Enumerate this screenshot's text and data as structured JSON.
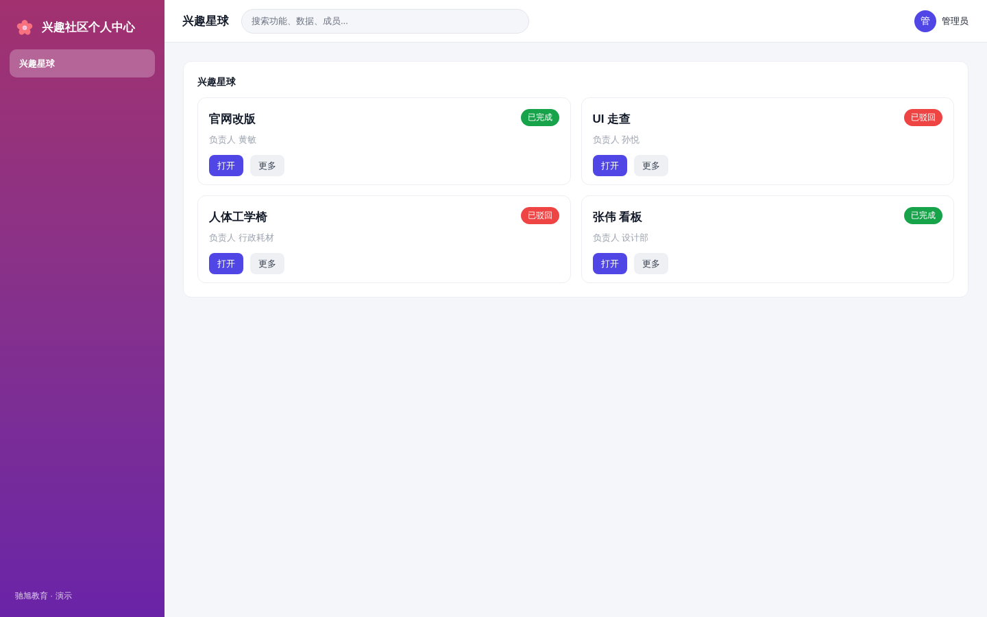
{
  "sidebar": {
    "brand": "兴趣社区个人中心",
    "items": [
      {
        "label": "兴趣星球",
        "selected": true
      }
    ],
    "footer": "驰旭教育 · 演示"
  },
  "header": {
    "title": "兴趣星球",
    "search": {
      "placeholder": "搜索功能、数据、成员..."
    },
    "user": {
      "avatar": "管",
      "name": "管理员"
    }
  },
  "panel": {
    "title": "兴趣星球",
    "cards": [
      {
        "title": "官网改版",
        "status": {
          "label": "已完成",
          "kind": "done"
        },
        "owner": "负责人 黄敏",
        "actions": [
          "打开",
          "更多"
        ]
      },
      {
        "title": "UI 走查",
        "status": {
          "label": "已驳回",
          "kind": "rejected"
        },
        "owner": "负责人 孙悦",
        "actions": [
          "打开",
          "更多"
        ]
      },
      {
        "title": "人体工学椅",
        "status": {
          "label": "已驳回",
          "kind": "rejected"
        },
        "owner": "负责人 行政耗材",
        "actions": [
          "打开",
          "更多"
        ]
      },
      {
        "title": "张伟 看板",
        "status": {
          "label": "已完成",
          "kind": "done"
        },
        "owner": "负责人 设计部",
        "actions": [
          "打开",
          "更多"
        ]
      }
    ]
  }
}
